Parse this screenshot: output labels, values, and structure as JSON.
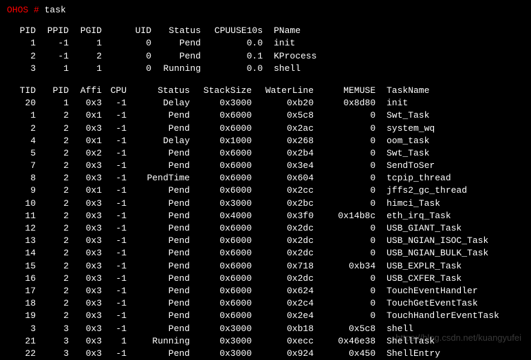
{
  "prompt": {
    "host": "OHOS #",
    "command": "task"
  },
  "proc_headers": [
    "PID",
    "PPID",
    "PGID",
    "UID",
    "Status",
    "CPUUSE10s",
    "PName"
  ],
  "procs": [
    {
      "pid": "1",
      "ppid": "-1",
      "pgid": "1",
      "uid": "0",
      "status": "Pend",
      "cpuuse": "0.0",
      "pname": "init"
    },
    {
      "pid": "2",
      "ppid": "-1",
      "pgid": "2",
      "uid": "0",
      "status": "Pend",
      "cpuuse": "0.1",
      "pname": "KProcess"
    },
    {
      "pid": "3",
      "ppid": "1",
      "pgid": "1",
      "uid": "0",
      "status": "Running",
      "cpuuse": "0.0",
      "pname": "shell"
    }
  ],
  "task_headers": [
    "TID",
    "PID",
    "Affi",
    "CPU",
    "Status",
    "StackSize",
    "WaterLine",
    "MEMUSE",
    "TaskName"
  ],
  "tasks": [
    {
      "tid": "20",
      "pid": "1",
      "affi": "0x3",
      "cpu": "-1",
      "status": "Delay",
      "stk": "0x3000",
      "wl": "0xb20",
      "mem": "0x8d80",
      "name": "init"
    },
    {
      "tid": "1",
      "pid": "2",
      "affi": "0x1",
      "cpu": "-1",
      "status": "Pend",
      "stk": "0x6000",
      "wl": "0x5c8",
      "mem": "0",
      "name": "Swt_Task"
    },
    {
      "tid": "2",
      "pid": "2",
      "affi": "0x3",
      "cpu": "-1",
      "status": "Pend",
      "stk": "0x6000",
      "wl": "0x2ac",
      "mem": "0",
      "name": "system_wq"
    },
    {
      "tid": "4",
      "pid": "2",
      "affi": "0x1",
      "cpu": "-1",
      "status": "Delay",
      "stk": "0x1000",
      "wl": "0x268",
      "mem": "0",
      "name": "oom_task"
    },
    {
      "tid": "5",
      "pid": "2",
      "affi": "0x2",
      "cpu": "-1",
      "status": "Pend",
      "stk": "0x6000",
      "wl": "0x2b4",
      "mem": "0",
      "name": "Swt_Task"
    },
    {
      "tid": "7",
      "pid": "2",
      "affi": "0x3",
      "cpu": "-1",
      "status": "Pend",
      "stk": "0x6000",
      "wl": "0x3e4",
      "mem": "0",
      "name": "SendToSer"
    },
    {
      "tid": "8",
      "pid": "2",
      "affi": "0x3",
      "cpu": "-1",
      "status": "PendTime",
      "stk": "0x6000",
      "wl": "0x604",
      "mem": "0",
      "name": "tcpip_thread"
    },
    {
      "tid": "9",
      "pid": "2",
      "affi": "0x1",
      "cpu": "-1",
      "status": "Pend",
      "stk": "0x6000",
      "wl": "0x2cc",
      "mem": "0",
      "name": "jffs2_gc_thread"
    },
    {
      "tid": "10",
      "pid": "2",
      "affi": "0x3",
      "cpu": "-1",
      "status": "Pend",
      "stk": "0x3000",
      "wl": "0x2bc",
      "mem": "0",
      "name": "himci_Task"
    },
    {
      "tid": "11",
      "pid": "2",
      "affi": "0x3",
      "cpu": "-1",
      "status": "Pend",
      "stk": "0x4000",
      "wl": "0x3f0",
      "mem": "0x14b8c",
      "name": "eth_irq_Task"
    },
    {
      "tid": "12",
      "pid": "2",
      "affi": "0x3",
      "cpu": "-1",
      "status": "Pend",
      "stk": "0x6000",
      "wl": "0x2dc",
      "mem": "0",
      "name": "USB_GIANT_Task"
    },
    {
      "tid": "13",
      "pid": "2",
      "affi": "0x3",
      "cpu": "-1",
      "status": "Pend",
      "stk": "0x6000",
      "wl": "0x2dc",
      "mem": "0",
      "name": "USB_NGIAN_ISOC_Task"
    },
    {
      "tid": "14",
      "pid": "2",
      "affi": "0x3",
      "cpu": "-1",
      "status": "Pend",
      "stk": "0x6000",
      "wl": "0x2dc",
      "mem": "0",
      "name": "USB_NGIAN_BULK_Task"
    },
    {
      "tid": "15",
      "pid": "2",
      "affi": "0x3",
      "cpu": "-1",
      "status": "Pend",
      "stk": "0x6000",
      "wl": "0x718",
      "mem": "0xb34",
      "name": "USB_EXPLR_Task"
    },
    {
      "tid": "16",
      "pid": "2",
      "affi": "0x3",
      "cpu": "-1",
      "status": "Pend",
      "stk": "0x6000",
      "wl": "0x2dc",
      "mem": "0",
      "name": "USB_CXFER_Task"
    },
    {
      "tid": "17",
      "pid": "2",
      "affi": "0x3",
      "cpu": "-1",
      "status": "Pend",
      "stk": "0x6000",
      "wl": "0x624",
      "mem": "0",
      "name": "TouchEventHandler"
    },
    {
      "tid": "18",
      "pid": "2",
      "affi": "0x3",
      "cpu": "-1",
      "status": "Pend",
      "stk": "0x6000",
      "wl": "0x2c4",
      "mem": "0",
      "name": "TouchGetEventTask"
    },
    {
      "tid": "19",
      "pid": "2",
      "affi": "0x3",
      "cpu": "-1",
      "status": "Pend",
      "stk": "0x6000",
      "wl": "0x2e4",
      "mem": "0",
      "name": "TouchHandlerEventTask"
    },
    {
      "tid": "3",
      "pid": "3",
      "affi": "0x3",
      "cpu": "-1",
      "status": "Pend",
      "stk": "0x3000",
      "wl": "0xb18",
      "mem": "0x5c8",
      "name": "shell"
    },
    {
      "tid": "21",
      "pid": "3",
      "affi": "0x3",
      "cpu": "1",
      "status": "Running",
      "stk": "0x3000",
      "wl": "0xecc",
      "mem": "0x46e38",
      "name": "ShellTask"
    },
    {
      "tid": "22",
      "pid": "3",
      "affi": "0x3",
      "cpu": "-1",
      "status": "Pend",
      "stk": "0x3000",
      "wl": "0x924",
      "mem": "0x450",
      "name": "ShellEntry"
    }
  ],
  "watermark": "https://blog.csdn.net/kuangyufei"
}
